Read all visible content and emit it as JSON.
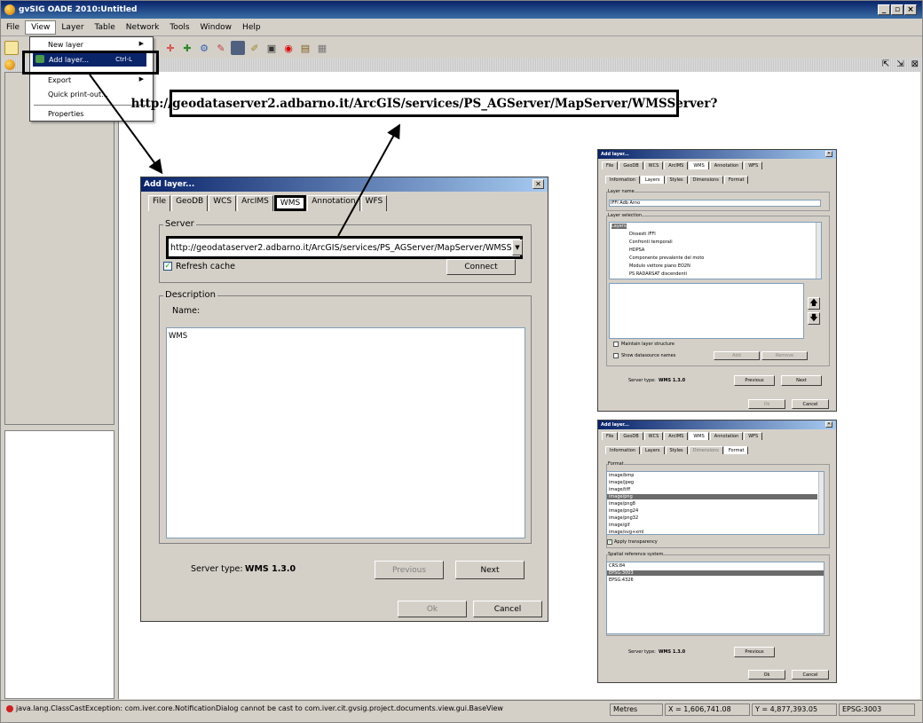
{
  "app": {
    "title": "gvSIG OADE 2010:Untitled",
    "window_buttons": [
      "_",
      "▫",
      "×"
    ]
  },
  "menubar": {
    "items": [
      "File",
      "View",
      "Layer",
      "Table",
      "Network",
      "Tools",
      "Window",
      "Help"
    ]
  },
  "view_menu": {
    "items": [
      {
        "label": "New layer",
        "submenu": true
      },
      {
        "label": "Add layer...",
        "shortcut": "Ctrl-L",
        "highlighted": true
      },
      {
        "label": "Export",
        "submenu": true
      },
      {
        "label": "Quick print-out..."
      },
      {
        "label": "Properties"
      }
    ]
  },
  "callout_url": "http://geodataserver2.adbarno.it/ArcGIS/services/PS_AGServer/MapServer/WMSServer?",
  "add_layer_dialog": {
    "title": "Add layer...",
    "tabs": [
      "File",
      "GeoDB",
      "WCS",
      "ArcIMS",
      "WMS",
      "Annotation",
      "WFS"
    ],
    "active_tab": "WMS",
    "server_group": "Server",
    "server_url": "http://geodataserver2.adbarno.it/ArcGIS/services/PS_AGServer/MapServer/WMSServer?",
    "refresh_cache": "Refresh cache",
    "connect": "Connect",
    "description_group": "Description",
    "name_label": "Name:",
    "description_text": "WMS",
    "server_type_label": "Server type:",
    "server_type_value": "WMS 1.3.0",
    "previous": "Previous",
    "next": "Next",
    "ok": "Ok",
    "cancel": "Cancel"
  },
  "layers_dialog": {
    "title": "Add layer...",
    "tabs": [
      "File",
      "GeoDB",
      "WCS",
      "ArcIMS",
      "WMS",
      "Annotation",
      "WFS"
    ],
    "subtabs": [
      "Information",
      "Layers",
      "Styles",
      "Dimensions",
      "Format"
    ],
    "layer_name_group": "Layer name",
    "layer_name_value": "IFFI Adb Arno",
    "layer_selection_group": "Layer selection",
    "tree_root": "Layers",
    "tree_items": [
      "Dissesti IFFI",
      "Confronti temporali",
      "HDPSA",
      "Componente prevalente del moto",
      "Modulo vettore piano EO2N",
      "PS RADARSAT discendenti"
    ],
    "maintain_structure": "Maintain layer structure",
    "show_names": "Show datasource names",
    "add": "Add",
    "remove": "Remove",
    "server_type_label": "Server type:",
    "server_type_value": "WMS 1.3.0",
    "previous": "Previous",
    "next": "Next",
    "ok": "Ok",
    "cancel": "Cancel"
  },
  "format_dialog": {
    "title": "Add layer...",
    "tabs": [
      "File",
      "GeoDB",
      "WCS",
      "ArcIMS",
      "WMS",
      "Annotation",
      "WFS"
    ],
    "subtabs": [
      "Information",
      "Layers",
      "Styles",
      "Dimensions",
      "Format"
    ],
    "format_group": "Format",
    "formats": [
      "image/bmp",
      "image/jpeg",
      "image/tiff",
      "image/png",
      "image/png8",
      "image/png24",
      "image/png32",
      "image/gif",
      "image/svg+xml"
    ],
    "selected_format": "image/png",
    "apply_transparency": "Apply transparency",
    "srs_group": "Spatial reference system",
    "srs_list": [
      "CRS:84",
      "EPSG:3003",
      "EPSG:4326"
    ],
    "selected_srs": "EPSG:3003",
    "server_type_label": "Server type:",
    "server_type_value": "WMS 1.3.0",
    "previous": "Previous",
    "ok": "Ok",
    "cancel": "Cancel"
  },
  "statusbar": {
    "message": "java.lang.ClassCastException: com.iver.core.NotificationDialog cannot be cast to com.iver.cit.gvsig.project.documents.view.gui.BaseView",
    "units": "Metres",
    "x": "X = 1,606,741.08",
    "y": "Y = 4,877,393.05",
    "crs": "EPSG:3003"
  }
}
